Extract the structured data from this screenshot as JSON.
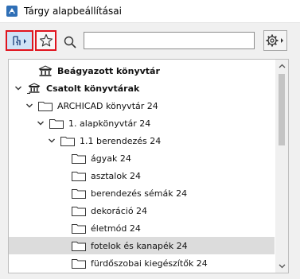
{
  "window": {
    "title": "Tárgy alapbeállításai"
  },
  "toolbar": {
    "library_button_icon": "library-object-icon",
    "favorites_button_icon": "star-icon",
    "search_icon": "search-icon",
    "search": {
      "value": "",
      "placeholder": ""
    },
    "settings_button_icon": "gear-icon",
    "highlight_color": "#e0141e"
  },
  "tree": {
    "items": [
      {
        "label": "Beágyazott könyvtár",
        "bold": true,
        "expanded": null,
        "icon": "library-icon"
      },
      {
        "label": "Csatolt könyvtárak",
        "bold": true,
        "expanded": true,
        "icon": "linked-library-icon"
      },
      {
        "label": "ARCHICAD könyvtár 24",
        "bold": false,
        "expanded": true,
        "icon": "folder-icon"
      },
      {
        "label": "1. alapkönyvtár 24",
        "bold": false,
        "expanded": true,
        "icon": "folder-icon"
      },
      {
        "label": "1.1 berendezés 24",
        "bold": false,
        "expanded": true,
        "icon": "folder-icon"
      },
      {
        "label": "ágyak 24",
        "bold": false,
        "expanded": null,
        "icon": "folder-icon"
      },
      {
        "label": "asztalok 24",
        "bold": false,
        "expanded": null,
        "icon": "folder-icon"
      },
      {
        "label": "berendezés sémák 24",
        "bold": false,
        "expanded": null,
        "icon": "folder-icon"
      },
      {
        "label": "dekoráció 24",
        "bold": false,
        "expanded": null,
        "icon": "folder-icon"
      },
      {
        "label": "életmód 24",
        "bold": false,
        "expanded": null,
        "icon": "folder-icon"
      },
      {
        "label": "fotelok és kanapék 24",
        "bold": false,
        "expanded": null,
        "icon": "folder-icon",
        "selected": true
      },
      {
        "label": "fürdőszobai kiegészítők 24",
        "bold": false,
        "expanded": null,
        "icon": "folder-icon"
      }
    ]
  },
  "colors": {
    "selection": "#dcdcdc",
    "library_button_bg": "#cfe3f7"
  }
}
